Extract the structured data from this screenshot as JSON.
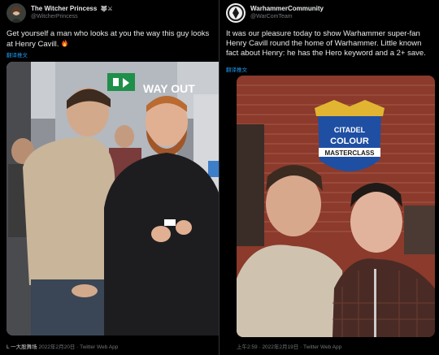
{
  "left_tweet": {
    "display_name": "The Witcher Princess",
    "name_badges": "🐺⚔",
    "handle": "@WitcherPrincess",
    "text": "Get yourself a man who looks at you the way  this guy looks at Henry Cavill.",
    "emoji": "fire-emoji",
    "translate_label": "翻译推文",
    "photo_sign_text": "WAY OUT",
    "footer_date": "2022年2月20日",
    "footer_source": "· Twitter Web App",
    "watermark": "L 一大股舞场"
  },
  "right_tweet": {
    "display_name": "WarhammerCommunity",
    "handle": "@WarComTeam",
    "text": "It was our pleasure today to show Warhammer super-fan Henry Cavill round the home of Warhammer. Little known fact about Henry: he has the Hero keyword and a 2+ save.",
    "translate_label": "翻译推文",
    "photo_logo_line1": "CITADEL",
    "photo_logo_line2": "COLOUR",
    "photo_logo_line3": "MASTERCLASS",
    "footer_time": "上午2:59",
    "footer_date": "· 2022年2月19日",
    "footer_source": "· Twitter Web App"
  },
  "colors": {
    "background": "#000000",
    "text": "#e7e9ea",
    "muted": "#71767b",
    "link": "#1d9bf0",
    "divider": "#2f3336"
  }
}
